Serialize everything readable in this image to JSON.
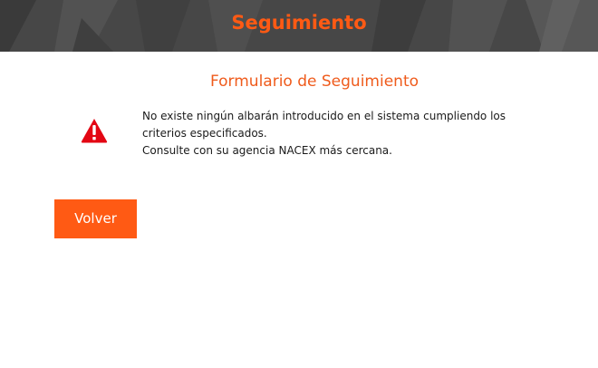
{
  "header": {
    "title": "Seguimiento"
  },
  "form": {
    "title": "Formulario de Seguimiento",
    "warning_icon": "warning-triangle-icon",
    "message_line1": "No existe ningún albarán introducido en el sistema cumpliendo los criterios especificados.",
    "message_line2": "Consulte con su agencia NACEX más cercana."
  },
  "actions": {
    "back_label": "Volver"
  },
  "colors": {
    "accent": "#ff5a14",
    "header_bg": "#4a4a4a",
    "warning_red": "#e30613"
  }
}
